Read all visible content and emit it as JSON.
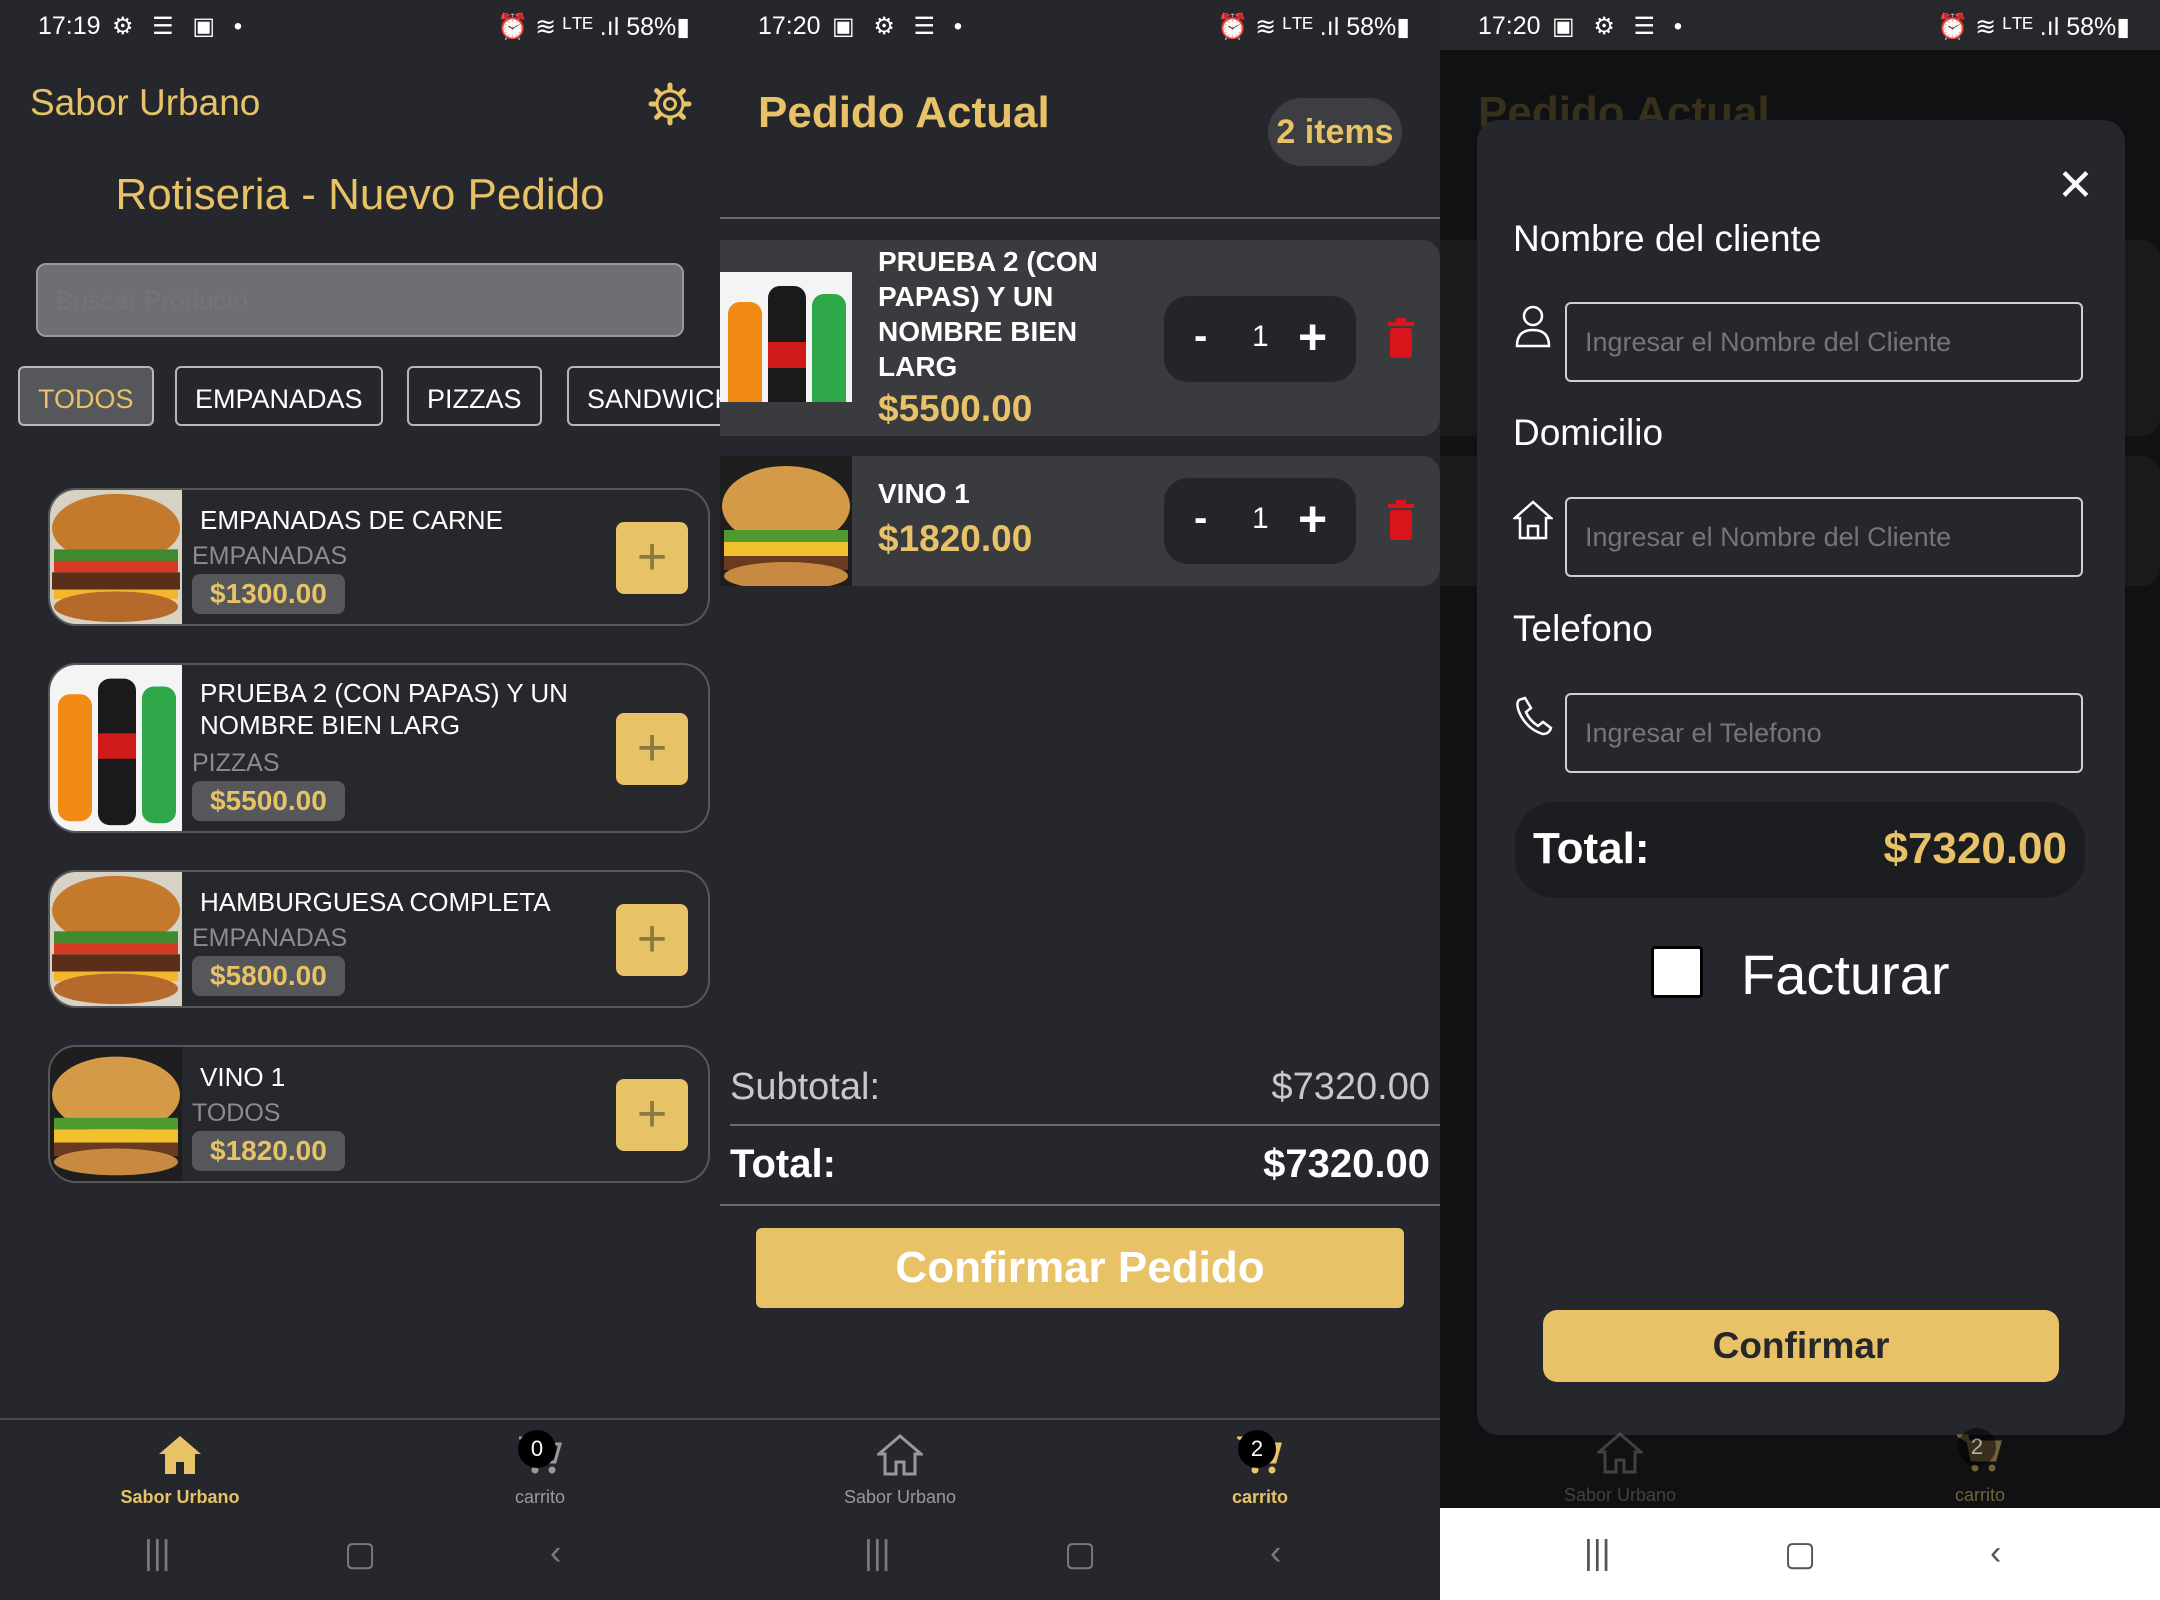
{
  "colors": {
    "accent": "#e7c267",
    "background": "#25272c",
    "delete": "#d9151b"
  },
  "screen1": {
    "status": {
      "time": "17:19",
      "icons": "⚙ ☰ ▣ •",
      "right": "⏰ ≋ ᴸᵀᴱ .ıl 58%▮"
    },
    "brand": "Sabor Urbano",
    "title": "Rotiseria - Nuevo Pedido",
    "search_placeholder": "Buscar Producto",
    "categories": [
      "TODOS",
      "EMPANADAS",
      "PIZZAS",
      "SANDWICH"
    ],
    "products": [
      {
        "name": "EMPANADAS DE CARNE",
        "category": "EMPANADAS",
        "price": "$1300.00",
        "image": "burger-image"
      },
      {
        "name": "PRUEBA 2 (CON PAPAS) Y UN NOMBRE BIEN LARG",
        "category": "PIZZAS",
        "price": "$5500.00",
        "image": "sodas-image"
      },
      {
        "name": "HAMBURGUESA COMPLETA",
        "category": "EMPANADAS",
        "price": "$5800.00",
        "image": "burger-image"
      },
      {
        "name": "VINO 1",
        "category": "TODOS",
        "price": "$1820.00",
        "image": "sandwich-image"
      }
    ],
    "add_label": "+",
    "nav": {
      "home": "Sabor Urbano",
      "cart": "carrito",
      "cart_count": "0"
    }
  },
  "screen2": {
    "status": {
      "time": "17:20",
      "icons": "▣ ⚙ ☰ •",
      "right": "⏰ ≋ ᴸᵀᴱ .ıl 58%▮"
    },
    "title": "Pedido Actual",
    "items_badge": "2 items",
    "order": [
      {
        "name": "PRUEBA 2 (CON PAPAS) Y UN NOMBRE BIEN LARG",
        "price": "$5500.00",
        "qty": "1",
        "image": "sodas-image"
      },
      {
        "name": "VINO 1",
        "price": "$1820.00",
        "qty": "1",
        "image": "sandwich-image"
      }
    ],
    "minus": "-",
    "plus": "+",
    "subtotal_label": "Subtotal:",
    "subtotal": "$7320.00",
    "total_label": "Total:",
    "total": "$7320.00",
    "confirm": "Confirmar Pedido",
    "nav": {
      "home": "Sabor Urbano",
      "cart": "carrito",
      "cart_count": "2"
    }
  },
  "screen3": {
    "status": {
      "time": "17:20",
      "icons": "▣ ⚙ ☰ •",
      "right": "⏰ ≋ ᴸᵀᴱ .ıl 58%▮"
    },
    "close": "✕",
    "cliente_label": "Nombre del cliente",
    "cliente_placeholder": "Ingresar el Nombre del Cliente",
    "domicilio_label": "Domicilio",
    "domicilio_placeholder": "Ingresar el Nombre del Cliente",
    "telefono_label": "Telefono",
    "telefono_placeholder": "Ingresar el Telefono",
    "total_label": "Total:",
    "total": "$7320.00",
    "facturar": "Facturar",
    "confirm": "Confirmar",
    "nav": {
      "home": "Sabor Urbano",
      "cart": "carrito",
      "cart_count": "2"
    }
  }
}
